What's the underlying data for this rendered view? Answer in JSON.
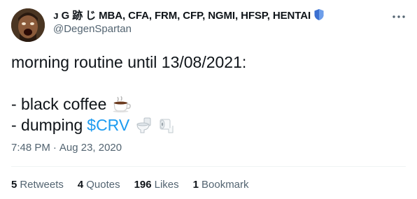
{
  "author": {
    "display_name": "ᴊ G 跡 じ MBA, CFA, FRM, CFP, NGMI, HFSP, HENTAI",
    "handle": "@DegenSpartan",
    "badge_icon": "shield-icon",
    "badge_color": "#3b6fd0"
  },
  "tweet": {
    "line1": "morning routine until 13/08/2021:",
    "line3": "- black coffee",
    "line4_prefix": "- dumping",
    "cashtag": "$CRV",
    "emojis": [
      "coffee-icon",
      "toilet-icon",
      "toilet-paper-icon"
    ]
  },
  "meta": {
    "time": "7:48 PM",
    "separator": "·",
    "date": "Aug 23, 2020"
  },
  "stats": {
    "retweets_count": "5",
    "retweets_label": "Retweets",
    "quotes_count": "4",
    "quotes_label": "Quotes",
    "likes_count": "196",
    "likes_label": "Likes",
    "bookmarks_count": "1",
    "bookmarks_label": "Bookmark"
  },
  "colors": {
    "text": "#0f1419",
    "muted": "#536471",
    "link": "#1d9bf0",
    "divider": "#eff3f4"
  }
}
